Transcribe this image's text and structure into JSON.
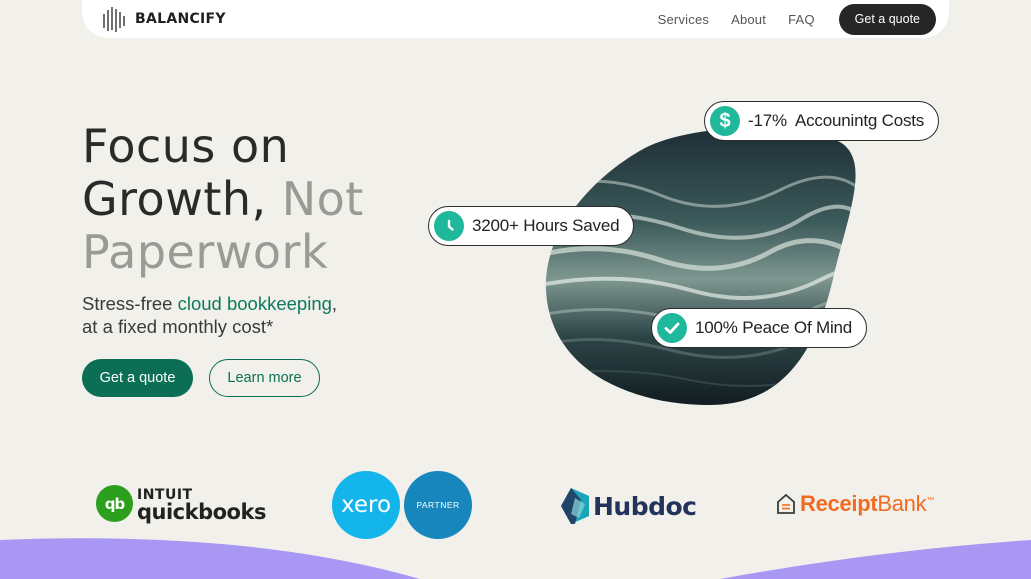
{
  "nav": {
    "logo_text": "BALANCIFY",
    "links": [
      "Services",
      "About",
      "FAQ"
    ],
    "cta_label": "Get a quote"
  },
  "hero": {
    "title_line1": "Focus on",
    "title_line2_dark": "Growth,",
    "title_line2_muted": "Not",
    "title_line3": "Paperwork",
    "subtitle_part1": "Stress-free",
    "subtitle_accent": "cloud bookkeeping",
    "subtitle_part2": ",",
    "subtitle_line2": "at a fixed monthly cost*",
    "primary_button": "Get a quote",
    "secondary_button": "Learn more"
  },
  "stats": {
    "costs": "-17%  Accounintg Costs",
    "hours": "3200+ Hours Saved",
    "peace": "100% Peace Of Mind",
    "icons": [
      "dollar-icon",
      "clock-icon",
      "check-icon"
    ]
  },
  "partners": {
    "quickbooks_intuit": "INTUIT",
    "quickbooks_name": "quickbooks",
    "quickbooks_mark": "qb",
    "xero_name": "xero",
    "xero_badge": "PARTNER",
    "hubdoc_name": "Hubdoc",
    "receipt_bold": "Receipt",
    "receipt_light": "Bank",
    "receipt_tm": "™"
  },
  "colors": {
    "background": "#f1f0ea",
    "accent_green": "#0c6f55",
    "stat_icon": "#1fb89a",
    "wave": "#a897f3",
    "dark_button": "#262626"
  }
}
